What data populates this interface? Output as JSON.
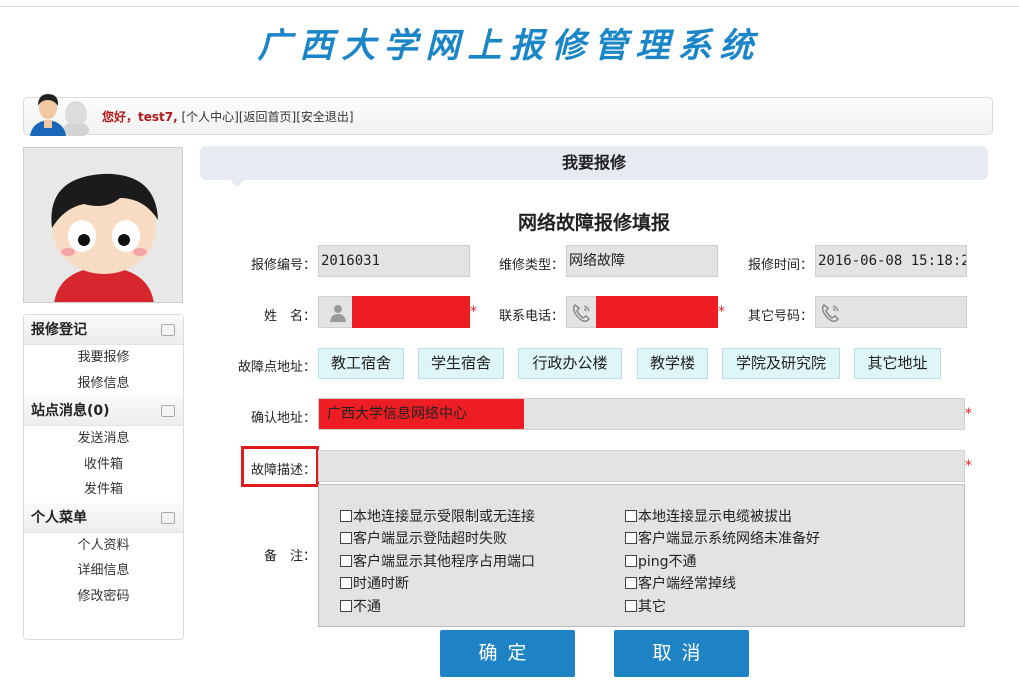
{
  "header": {
    "title": "广西大学网上报修管理系统"
  },
  "userbar": {
    "greeting": "您好，test7,",
    "links": [
      "[个人中心]",
      "[返回首页]",
      "[安全退出]"
    ]
  },
  "sidebar": {
    "sections": [
      {
        "title": "报修登记",
        "items": [
          "我要报修",
          "报修信息"
        ]
      },
      {
        "title": "站点消息(0)",
        "items": [
          "发送消息",
          "收件箱",
          "发件箱"
        ]
      },
      {
        "title": "个人菜单",
        "items": [
          "个人资料",
          "详细信息",
          "修改密码"
        ]
      }
    ]
  },
  "panel": {
    "title": "我要报修"
  },
  "form": {
    "title": "网络故障报修填报",
    "labels": {
      "repair_no": "报修编号：",
      "repair_type": "维修类型：",
      "repair_time": "报修时间：",
      "name": "姓　名：",
      "phone": "联系电话：",
      "other_phone": "其它号码：",
      "location": "故障点地址：",
      "confirm_address": "确认地址：",
      "description": "故障描述：",
      "remarks": "备　注："
    },
    "values": {
      "repair_no": "2016031",
      "repair_type": "网络故障",
      "repair_time": "2016-06-08 15:18:2",
      "confirm_address": "广西大学信息网络中心",
      "description": ""
    },
    "required_mark": "*",
    "location_buttons": [
      "教工宿舍",
      "学生宿舍",
      "行政办公楼",
      "教学楼",
      "学院及研究院",
      "其它地址"
    ],
    "remark_options_left": [
      "本地连接显示受限制或无连接",
      "客户端显示登陆超时失败",
      "客户端显示其他程序占用端口",
      "时通时断",
      "不通"
    ],
    "remark_options_right": [
      "本地连接显示电缆被拔出",
      "客户端显示系统网络未准备好",
      "ping不通",
      "客户端经常掉线",
      "其它"
    ],
    "buttons": {
      "confirm": "确定",
      "cancel": "取消"
    }
  },
  "colors": {
    "title": "#1a86c8",
    "button": "#1e83c5",
    "redaction": "#ee1d24",
    "highlight": "#e01c1c"
  }
}
